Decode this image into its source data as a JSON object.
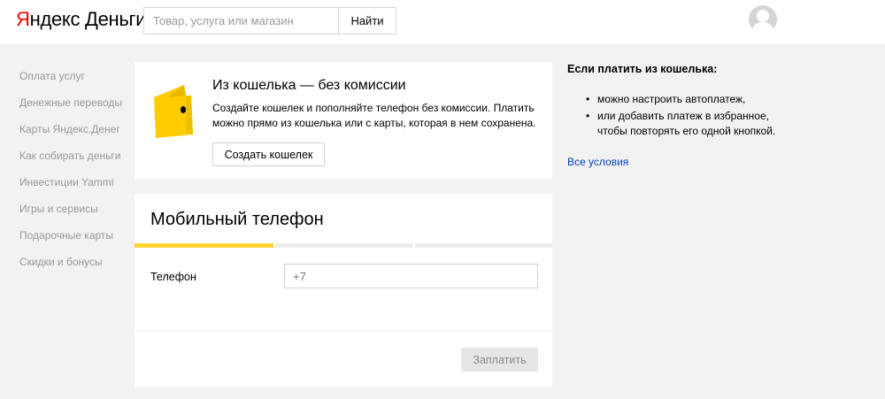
{
  "header": {
    "logo_first": "Я",
    "logo_rest": "ндекс Деньги",
    "search_placeholder": "Товар, услуга или магазин",
    "search_button": "Найти"
  },
  "sidebar": {
    "items": [
      {
        "label": "Оплата услуг"
      },
      {
        "label": "Денежные переводы"
      },
      {
        "label": "Карты Яндекс.Денег"
      },
      {
        "label": "Как собирать деньги"
      },
      {
        "label": "Инвестиции Yammi"
      },
      {
        "label": "Игры и сервисы"
      },
      {
        "label": "Подарочные карты"
      },
      {
        "label": "Скидки и бонусы"
      }
    ]
  },
  "promo": {
    "title": "Из кошелька — без комиссии",
    "text": "Создайте кошелек и пополняйте телефон без комиссии. Платить можно прямо из кошелька или с карты, которая в нем сохранена.",
    "button": "Создать кошелек",
    "icon": "wallet-icon"
  },
  "payment": {
    "title": "Мобильный телефон",
    "steps_total": 3,
    "current_step": 1,
    "phone_label": "Телефон",
    "phone_placeholder": "+7",
    "pay_button": "Заплатить"
  },
  "info": {
    "title": "Если платить из кошелька:",
    "bullets": [
      "можно настроить автоплатеж,",
      "или добавить платеж в избранное, чтобы повторять его одной кнопкой."
    ],
    "link": "Все условия"
  },
  "colors": {
    "brand_red": "#ff0000",
    "accent_yellow": "#ffd234",
    "link_blue": "#0044bb",
    "page_bg": "#f2f2f2"
  }
}
